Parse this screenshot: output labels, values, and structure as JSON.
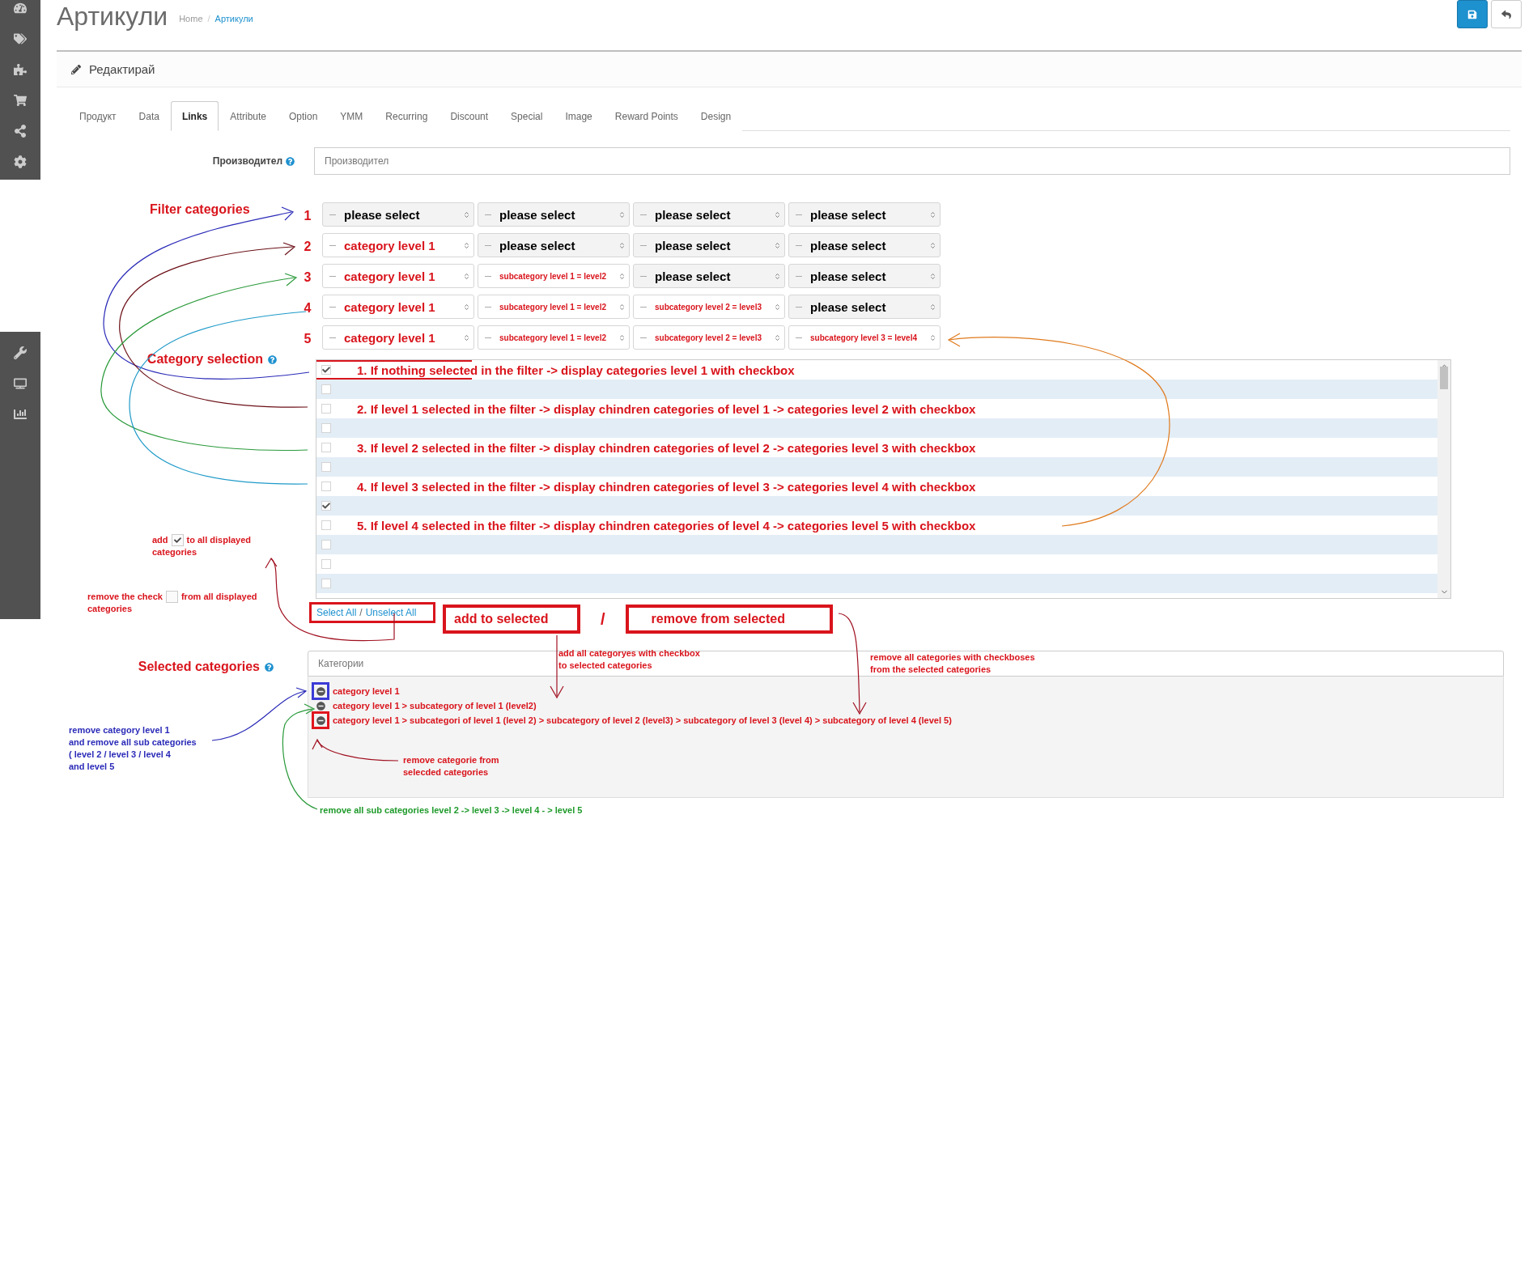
{
  "page": {
    "title": "Артикули",
    "breadcrumb": [
      "Home",
      "Артикули"
    ],
    "breadcrumb_separator": "/"
  },
  "panel": {
    "heading": "Редактирай",
    "tabs": [
      {
        "label": "Продукт",
        "selected": false
      },
      {
        "label": "Data",
        "selected": false
      },
      {
        "label": "Links",
        "selected": true
      },
      {
        "label": "Attribute",
        "selected": false
      },
      {
        "label": "Option",
        "selected": false
      },
      {
        "label": "YMM",
        "selected": false
      },
      {
        "label": "Recurring",
        "selected": false
      },
      {
        "label": "Discount",
        "selected": false
      },
      {
        "label": "Special",
        "selected": false
      },
      {
        "label": "Image",
        "selected": false
      },
      {
        "label": "Reward Points",
        "selected": false
      },
      {
        "label": "Design",
        "selected": false
      }
    ]
  },
  "manufacturer": {
    "label": "Производител",
    "placeholder": "Производител"
  },
  "filter": {
    "label": "Filter categories",
    "rows": [
      {
        "number": "1",
        "selects": [
          {
            "kind": "placeholder",
            "value": "please select"
          },
          {
            "kind": "placeholder",
            "value": "please select"
          },
          {
            "kind": "placeholder",
            "value": "please select"
          },
          {
            "kind": "placeholder",
            "value": "please select"
          }
        ]
      },
      {
        "number": "2",
        "selects": [
          {
            "kind": "category",
            "value": "category level 1"
          },
          {
            "kind": "placeholder",
            "value": "please select"
          },
          {
            "kind": "placeholder",
            "value": "please select"
          },
          {
            "kind": "placeholder",
            "value": "please select"
          }
        ]
      },
      {
        "number": "3",
        "selects": [
          {
            "kind": "category",
            "value": "category level 1"
          },
          {
            "kind": "subcategory",
            "value": "subcategory level 1 = level2"
          },
          {
            "kind": "placeholder",
            "value": "please select"
          },
          {
            "kind": "placeholder",
            "value": "please select"
          }
        ]
      },
      {
        "number": "4",
        "selects": [
          {
            "kind": "category",
            "value": "category level 1"
          },
          {
            "kind": "subcategory",
            "value": "subcategory level 1 = level2"
          },
          {
            "kind": "subcategory",
            "value": "subcategory level 2 = level3"
          },
          {
            "kind": "placeholder",
            "value": "please select"
          }
        ]
      },
      {
        "number": "5",
        "selects": [
          {
            "kind": "category",
            "value": "category level 1"
          },
          {
            "kind": "subcategory",
            "value": "subcategory level 1 = level2"
          },
          {
            "kind": "subcategory",
            "value": "subcategory level 2 = level3"
          },
          {
            "kind": "subcategory",
            "value": "subcategory level 3 = level4"
          }
        ]
      }
    ]
  },
  "category_selection": {
    "label": "Category selection",
    "rows": [
      {
        "checked": true,
        "framed": true,
        "text": "1. If nothing selected  in the filter -> display categories level 1 with checkbox"
      },
      {
        "checked": false,
        "framed": false
      },
      {
        "checked": false,
        "framed": false,
        "text": "2. If level 1 selected  in the filter -> display chindren categories of level 1 -> categories level 2 with checkbox"
      },
      {
        "checked": false,
        "framed": false
      },
      {
        "checked": false,
        "framed": false,
        "text": "3. If level 2 selected  in the filter -> display chindren categories of level 2 -> categories level 3 with checkbox"
      },
      {
        "checked": false,
        "framed": false
      },
      {
        "checked": false,
        "framed": false,
        "text": "4. If level 3 selected  in the filter -> display chindren categories of level 3 -> categories level 4 with checkbox"
      },
      {
        "checked": true,
        "framed": false
      },
      {
        "checked": false,
        "framed": false,
        "text": "5. If level 4 selected  in the filter -> display chindren categories of level 4 -> categories level 5 with checkbox"
      },
      {
        "checked": false,
        "framed": false
      },
      {
        "checked": false,
        "framed": false
      },
      {
        "checked": false,
        "framed": false
      }
    ],
    "select_all": "Select All",
    "divider": "/",
    "unselect_all": "Unselect All"
  },
  "actions": {
    "add": "add to  selected",
    "separator": "/",
    "remove": "remove from selected"
  },
  "selected": {
    "label": "Selected categories",
    "placeholder": "Категории",
    "items": [
      {
        "text": "category level 1",
        "color": "#3b3bd6"
      },
      {
        "text": "category level 1 > subcategory of level 1 (level2)"
      },
      {
        "text": "category level 1 > subcategori of level 1 (level 2) > subcategory of level 2 (level3) > subcategory of level 3 (level 4) > subcategory of level 4 (level 5)",
        "color": "#e0161e"
      }
    ]
  },
  "annotations": [
    {
      "kind": "check",
      "before": "add",
      "after": "to all displayed",
      "lines": [
        "categories"
      ],
      "checked": true,
      "color": "#d9141c"
    },
    {
      "kind": "check",
      "before": "remove the check",
      "after": "from all displayed",
      "lines": [
        "categories"
      ],
      "checked": false,
      "color": "#d9141c"
    },
    {
      "kind": "note",
      "lines": [
        "add all categoryes with checkbox",
        "to selected categories"
      ],
      "color": "#d9141c"
    },
    {
      "kind": "note",
      "lines": [
        "remove all categories with checkboses",
        "from the selected categories"
      ],
      "color": "#d9141c"
    },
    {
      "kind": "note",
      "lines": [
        "remove category level 1",
        "and remove all sub categories",
        "( level 2 / level 3 / level  4",
        "and level 5"
      ],
      "color": "#2a2ab8"
    },
    {
      "kind": "note",
      "lines": [
        "remove categorie from",
        "selecded categories"
      ],
      "color": "#d9141c"
    },
    {
      "kind": "note",
      "lines": [
        "remove all sub categories level 2 -> level 3 -> level 4 - > level 5"
      ],
      "color": "#1e9a2a"
    }
  ]
}
